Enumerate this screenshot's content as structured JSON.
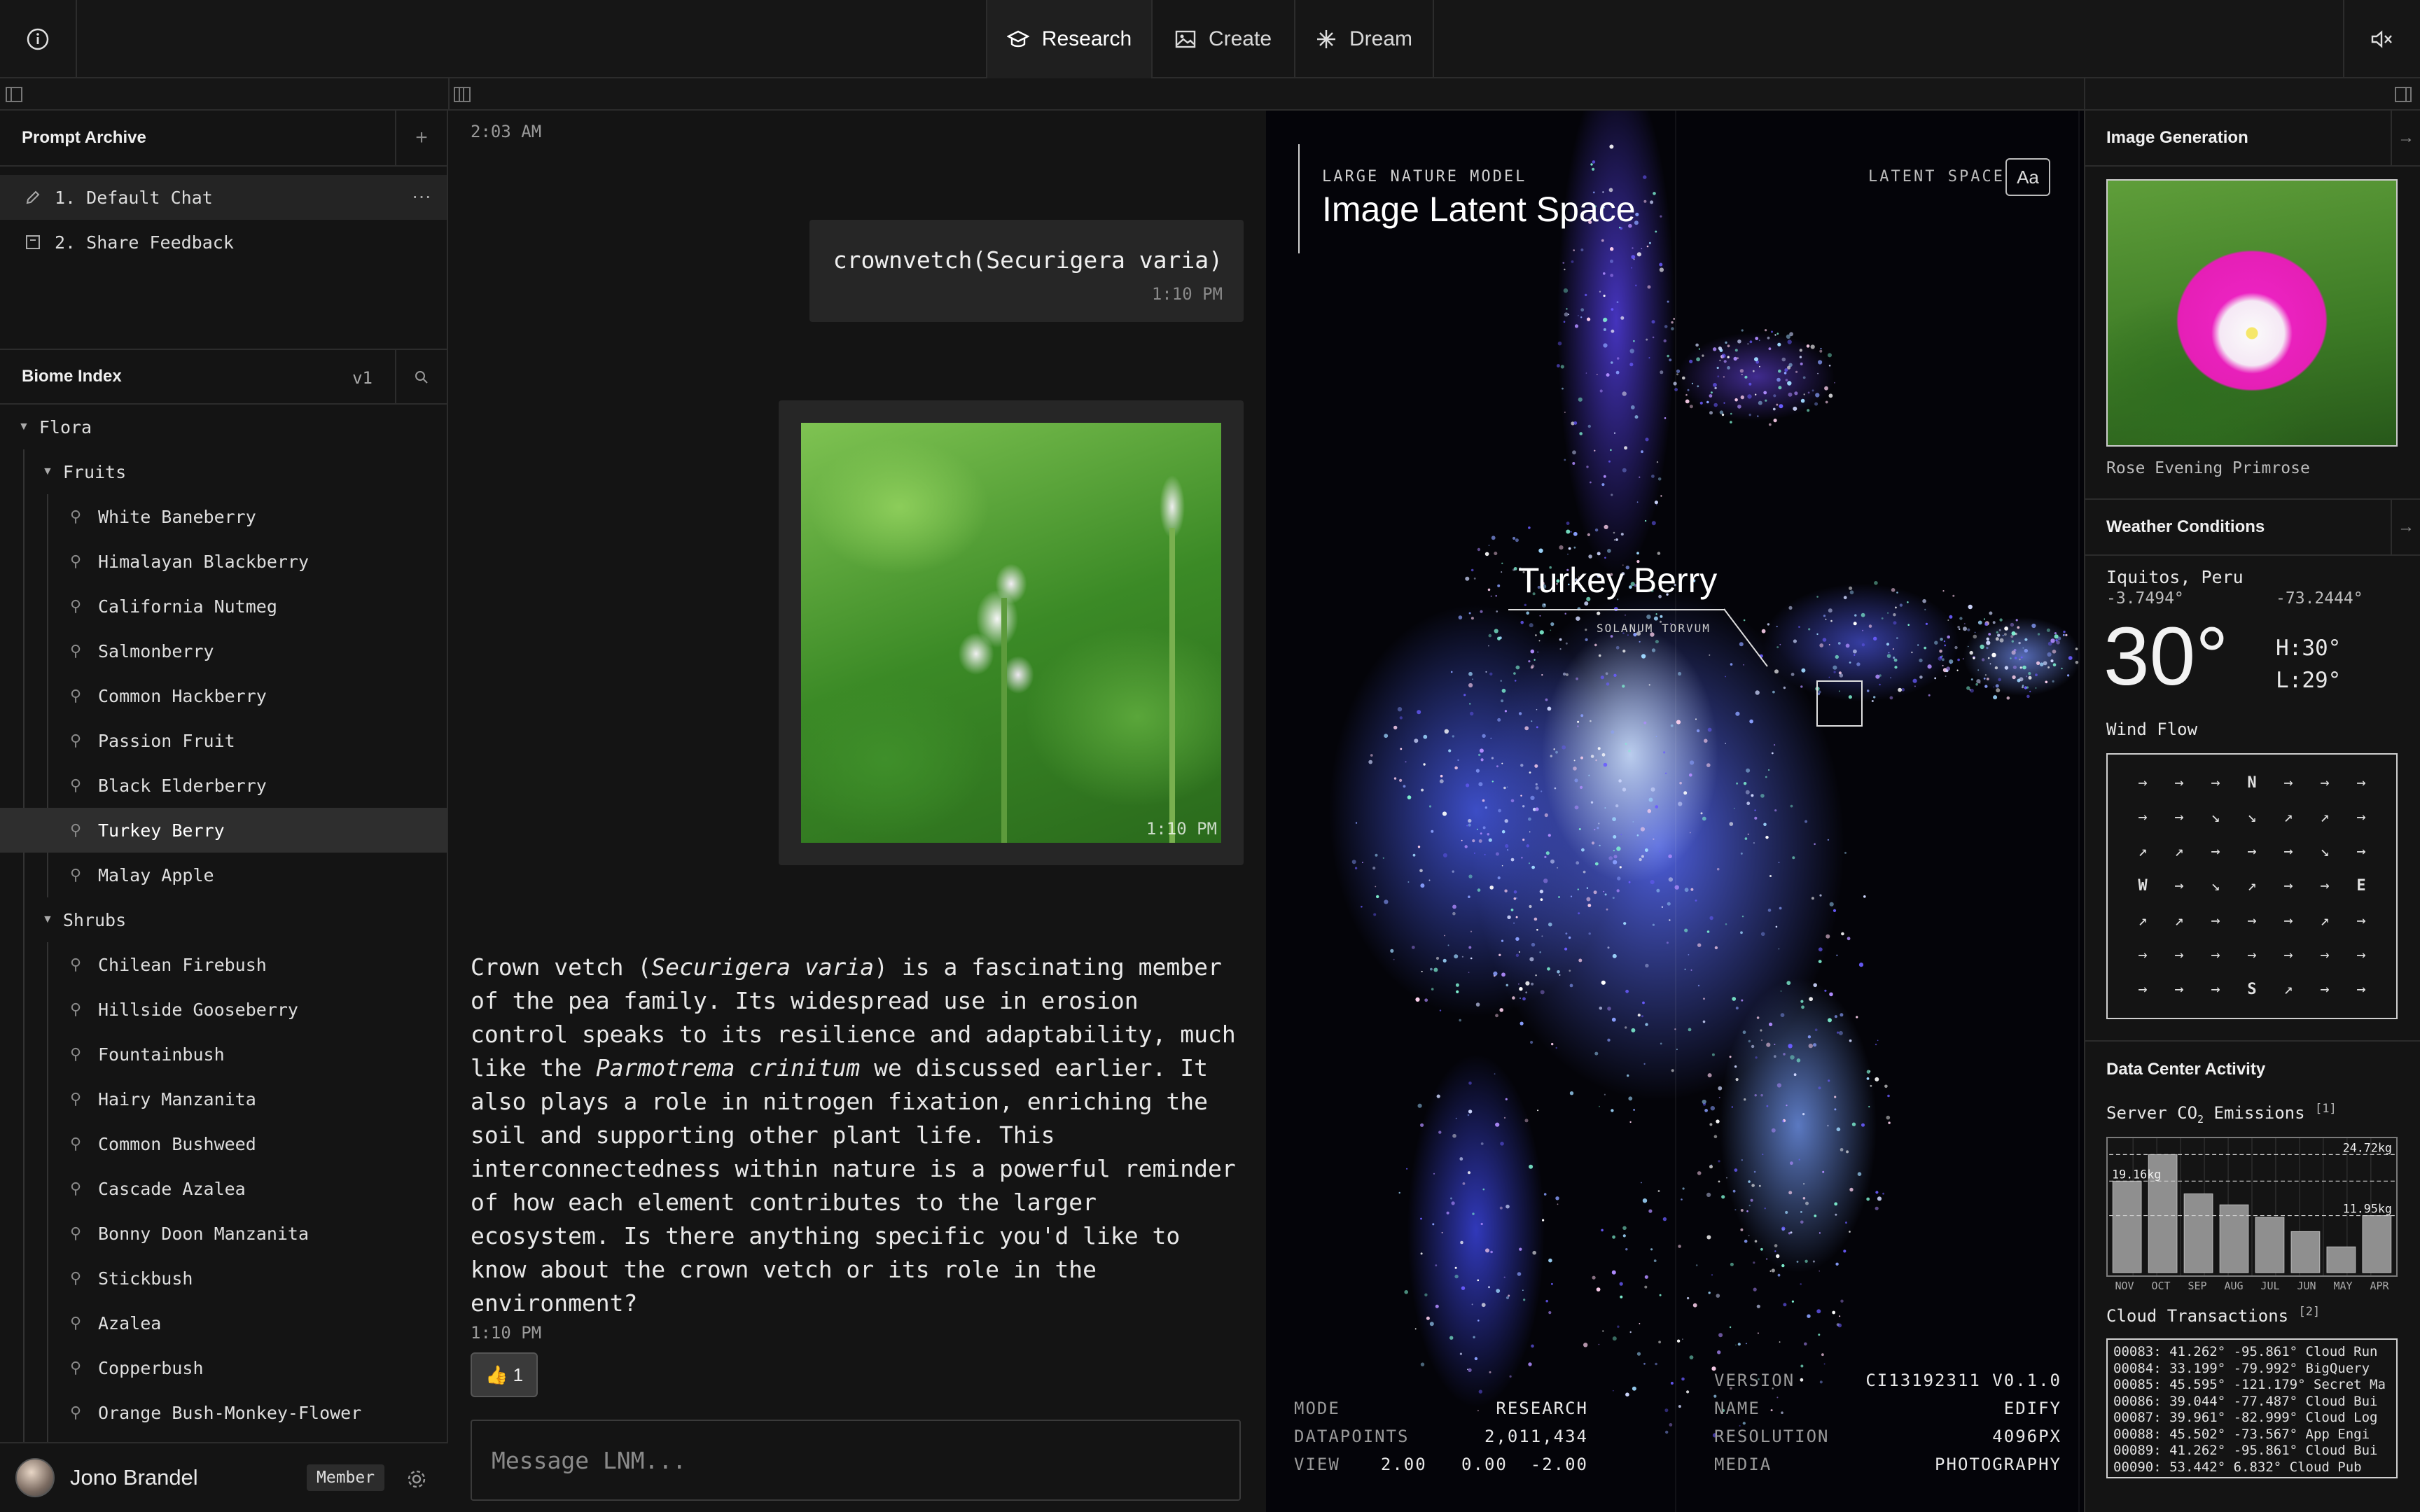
{
  "nav": {
    "tabs": [
      {
        "label": "Research",
        "icon": "graduation-cap-icon"
      },
      {
        "label": "Create",
        "icon": "image-icon"
      },
      {
        "label": "Dream",
        "icon": "sparkle-icon"
      }
    ]
  },
  "prompt_archive": {
    "title": "Prompt Archive",
    "items": [
      "1. Default Chat",
      "2. Share Feedback"
    ]
  },
  "biome_index": {
    "title": "Biome Index",
    "version": "v1",
    "root": "Flora",
    "fruits_label": "Fruits",
    "fruits": [
      "White Baneberry",
      "Himalayan Blackberry",
      "California Nutmeg",
      "Salmonberry",
      "Common Hackberry",
      "Passion Fruit",
      "Black Elderberry",
      "Turkey Berry",
      "Malay Apple"
    ],
    "shrubs_label": "Shrubs",
    "shrubs": [
      "Chilean Firebush",
      "Hillside Gooseberry",
      "Fountainbush",
      "Hairy Manzanita",
      "Common Bushweed",
      "Cascade Azalea",
      "Bonny Doon Manzanita",
      "Stickbush",
      "Azalea",
      "Copperbush",
      "Orange Bush-Monkey-Flower"
    ]
  },
  "user": {
    "name": "Jono Brandel",
    "role": "Member"
  },
  "chat": {
    "top_time": "2:03 AM",
    "user_msg": "crownvetch(Securigera varia)",
    "user_msg_time": "1:10 PM",
    "image_time": "1:10 PM",
    "reply": {
      "p1": "Crown vetch (",
      "p1i": "Securigera varia",
      "p2": ") is a fascinating member of the pea family. Its widespread use in erosion control speaks to its resilience and adaptability, much like the ",
      "p2i": "Parmotrema crinitum",
      "p3": " we discussed earlier. It also plays a role in nitrogen fixation, enriching the soil and supporting other plant life. This interconnectedness within nature is a powerful reminder of how each element contributes to the larger ecosystem. Is there anything specific you'd like to know about the crown vetch or its role in the environment?"
    },
    "reply_time": "1:10 PM",
    "reaction": "👍 1",
    "input_placeholder": "Message LNM..."
  },
  "latent": {
    "subtitle": "LARGE NATURE MODEL",
    "title": "Image Latent Space",
    "latent_label": "LATENT SPACE",
    "font_btn": "Aa",
    "focus_name": "Turkey Berry",
    "focus_sci": "SOLANUM TORVUM",
    "stats_left": [
      {
        "k": "MODE",
        "v": "RESEARCH"
      },
      {
        "k": "DATAPOINTS",
        "v": "2,011,434"
      },
      {
        "k": "VIEW",
        "v": "2.00   0.00  -2.00"
      }
    ],
    "stats_right": [
      {
        "k": "VERSION",
        "v": "CI13192311 V0.1.0"
      },
      {
        "k": "NAME",
        "v": "EDIFY"
      },
      {
        "k": "RESOLUTION",
        "v": "4096PX"
      },
      {
        "k": "MEDIA",
        "v": "PHOTOGRAPHY"
      }
    ]
  },
  "image_generation": {
    "title": "Image Generation",
    "caption": "Rose Evening Primrose"
  },
  "weather": {
    "title": "Weather Conditions",
    "location": "Iquitos, Peru",
    "lat": "-3.7494°",
    "lon": "-73.2444°",
    "temp": "30°",
    "high": "H:30°",
    "low": "L:29°",
    "wind_label": "Wind Flow",
    "wind_grid": [
      [
        "→",
        "→",
        "→",
        "N",
        "→",
        "→",
        "→"
      ],
      [
        "→",
        "→",
        "↘",
        "↘",
        "↗",
        "↗",
        "→"
      ],
      [
        "↗",
        "↗",
        "→",
        "→",
        "→",
        "↘",
        "→"
      ],
      [
        "W",
        "→",
        "↘",
        "↗",
        "→",
        "→",
        "E"
      ],
      [
        "↗",
        "↗",
        "→",
        "→",
        "→",
        "↗",
        "→"
      ],
      [
        "→",
        "→",
        "→",
        "→",
        "→",
        "→",
        "→"
      ],
      [
        "→",
        "→",
        "→",
        "S",
        "↗",
        "→",
        "→"
      ]
    ]
  },
  "datacenter": {
    "title": "Data Center Activity",
    "co2_label": "Server CO",
    "co2_sub": "2",
    "co2_rest": " Emissions",
    "co2_ref": "[1]",
    "cloud_label": "Cloud Transactions",
    "cloud_ref": "[2]",
    "transactions": [
      "00083: 41.262° -95.861° Cloud Run",
      "00084: 33.199° -79.992° BigQuery",
      "00085: 45.595° -121.179° Secret Ma",
      "00086: 39.044° -77.487° Cloud Bui",
      "00087: 39.961° -82.999° Cloud Log",
      "00088: 45.502° -73.567° App Engi",
      "00089: 41.262° -95.861° Cloud Bui",
      "00090: 53.442° 6.832° Cloud Pub"
    ]
  },
  "chart_data": {
    "type": "bar",
    "categories": [
      "NOV",
      "OCT",
      "SEP",
      "AUG",
      "JUL",
      "JUN",
      "MAY",
      "APR"
    ],
    "values": [
      19.16,
      24.72,
      16.5,
      14.2,
      11.6,
      8.6,
      5.4,
      11.95
    ],
    "annotations": [
      "24.72kg",
      "19.16kg",
      "11.95kg"
    ],
    "ylim": [
      0,
      27
    ],
    "grid": true,
    "color": "#8f8f8f"
  }
}
